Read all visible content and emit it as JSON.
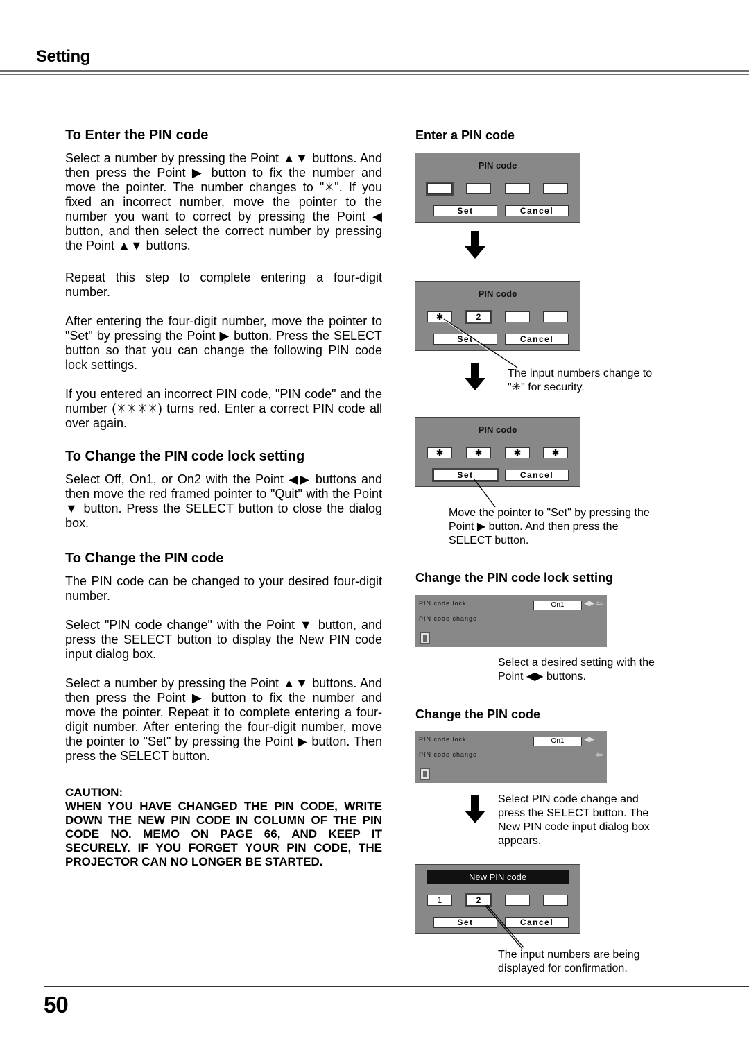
{
  "header": {
    "title": "Setting"
  },
  "left": {
    "enter": {
      "heading": "To Enter the PIN code",
      "p1": "Select a number by pressing the Point ▲▼ buttons. And then press the Point ▶ button to fix the number and move the pointer.  The number changes to \"✳\". If you fixed an incorrect number, move the pointer to the number you want to correct by pressing the Point ◀ button, and then select the correct number by pressing the Point ▲▼ buttons.",
      "p2": "Repeat this step to complete entering a four-digit number.",
      "p3": "After entering the four-digit number, move the pointer to \"Set\" by pressing the Point ▶ button. Press the SELECT button so that you can change the following PIN code lock settings.",
      "p4": "If you entered an incorrect PIN code, \"PIN code\" and the number (✳✳✳✳) turns red.  Enter a correct PIN code all over again."
    },
    "lock": {
      "heading": "To Change the PIN code lock setting",
      "p1": "Select Off, On1, or On2 with the Point ◀▶ buttons and then move the red framed pointer to \"Quit\" with the Point ▼ button.  Press the SELECT button to close the dialog box."
    },
    "change": {
      "heading": "To Change the PIN code",
      "p1": "The PIN code can be changed to your desired four-digit number.",
      "p2": "Select \"PIN code change\" with the Point ▼ button, and press the SELECT button to display the New PIN code input dialog box.",
      "p3": "Select a number by pressing the Point ▲▼ buttons. And then press the Point ▶ button to fix the number and move the pointer.  Repeat it to complete entering a four-digit number.  After entering the four-digit number, move the pointer to \"Set\" by pressing the Point ▶ button.  Then press the SELECT button."
    },
    "caution": {
      "label": "CAUTION:",
      "text": "WHEN YOU HAVE CHANGED THE PIN CODE, WRITE DOWN THE NEW PIN CODE IN COLUMN OF THE PIN CODE NO. MEMO ON PAGE 66, AND KEEP IT SECURELY. IF YOU FORGET YOUR PIN CODE, THE PROJECTOR CAN NO LONGER BE STARTED."
    }
  },
  "right": {
    "enter_heading": "Enter a PIN code",
    "dialog1": {
      "title": "PIN code",
      "digits": [
        "",
        "",
        "",
        ""
      ],
      "set": "Set",
      "cancel": "Cancel"
    },
    "dialog2": {
      "title": "PIN code",
      "digits": [
        "✱",
        "2",
        "",
        ""
      ],
      "set": "Set",
      "cancel": "Cancel"
    },
    "note2": "The input numbers change to \"✳\" for security.",
    "dialog3": {
      "title": "PIN code",
      "digits": [
        "✱",
        "✱",
        "✱",
        "✱"
      ],
      "set": "Set",
      "cancel": "Cancel"
    },
    "note3": "Move the pointer to \"Set\" by pressing the Point ▶ button.  And then press the SELECT button.",
    "lock_heading": "Change the PIN code lock setting",
    "menu1": {
      "row1": "PIN code lock",
      "row2": "PIN code change",
      "value": "On1",
      "arrows": "◀▶",
      "pointer": "⇦"
    },
    "note4": "Select a desired setting with the Point ◀▶ buttons.",
    "change_heading": "Change the PIN code",
    "menu2": {
      "row1": "PIN code lock",
      "row2": "PIN code change",
      "value": "On1",
      "arrows": "◀▶",
      "pointer": "⇦"
    },
    "note5": "Select PIN code change and press the SELECT button. The New PIN code input dialog box appears.",
    "dialog4": {
      "title": "New PIN code",
      "digits": [
        "1",
        "2",
        "",
        ""
      ],
      "set": "Set",
      "cancel": "Cancel"
    },
    "note6": "The input numbers are being displayed for confirmation."
  },
  "footer": {
    "page_number": "50"
  }
}
